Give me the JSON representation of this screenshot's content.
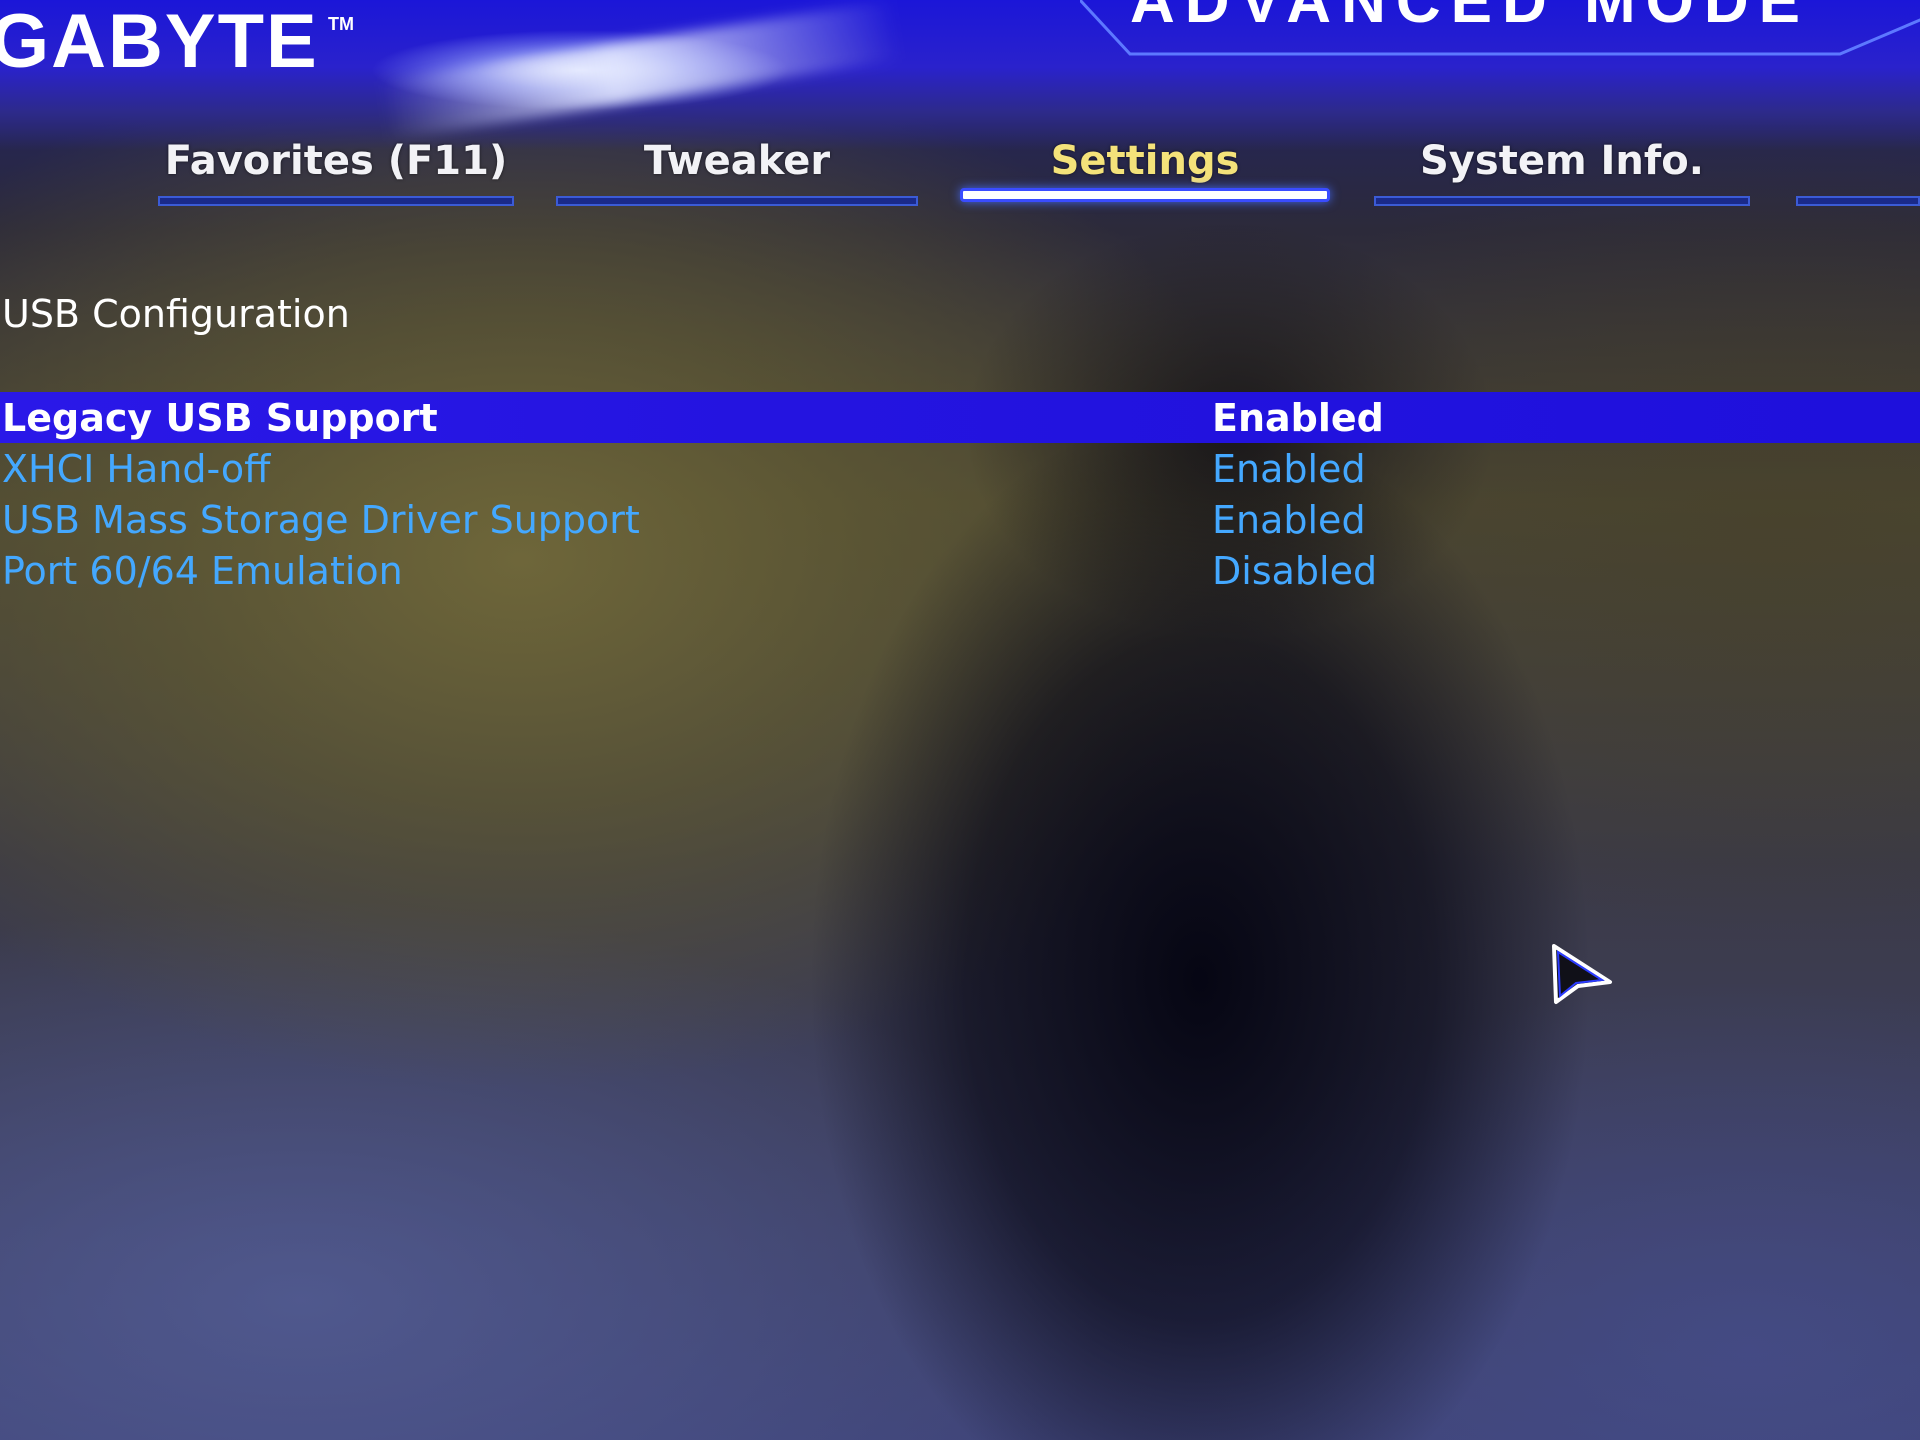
{
  "header": {
    "brand": "GABYTE",
    "trademark": "TM",
    "mode_title": "ADVANCED MODE"
  },
  "tabs": [
    {
      "label": "Favorites (F11)",
      "active": false
    },
    {
      "label": "Tweaker",
      "active": false
    },
    {
      "label": "Settings",
      "active": true
    },
    {
      "label": "System Info.",
      "active": false
    }
  ],
  "section": {
    "title": "USB Configuration"
  },
  "settings": [
    {
      "label": "Legacy USB Support",
      "value": "Enabled",
      "selected": true
    },
    {
      "label": "XHCI Hand-off",
      "value": "Enabled",
      "selected": false
    },
    {
      "label": "USB Mass Storage Driver Support",
      "value": "Enabled",
      "selected": false
    },
    {
      "label": "Port 60/64 Emulation",
      "value": "Disabled",
      "selected": false
    }
  ],
  "colors": {
    "highlight_bar": "#2414e0",
    "active_tab_text": "#f4e27a",
    "item_text": "#44a8ff",
    "selected_text": "#ffffff"
  },
  "icons": {
    "cursor": "mouse-pointer-icon"
  }
}
